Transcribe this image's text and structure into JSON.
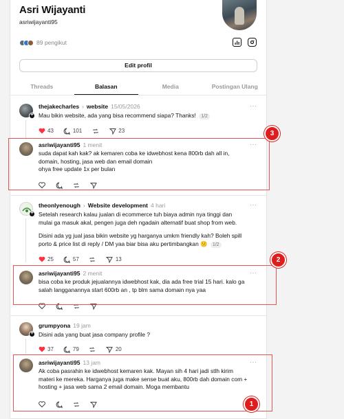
{
  "profile": {
    "name": "Asri Wijayanti",
    "handle": "asriwijayanti95",
    "followers": "89 pengikut",
    "edit_label": "Edit profil"
  },
  "tabs": [
    {
      "label": "Threads",
      "active": false
    },
    {
      "label": "Balasan",
      "active": true
    },
    {
      "label": "Media",
      "active": false
    },
    {
      "label": "Postingan Ulang",
      "active": false
    }
  ],
  "posts": {
    "p1": {
      "user": "thejakecharles",
      "topic": "website",
      "time": "15/05/2026",
      "text": "Mau bikin website, ada yang bisa recommend siapa? Thanks!",
      "pager": "1/2",
      "likes": "43",
      "comments": "101",
      "shares": "23"
    },
    "r1": {
      "user": "asriwijayanti95",
      "time": "1 menit",
      "line1": "suda dapat kah kak? ak kemaren coba ke idwebhost kena 800rb dah all in,",
      "line2": "domain, hosting, jasa web dan email domain",
      "line3": "ohya free update 1x per bulan"
    },
    "p2": {
      "user": "theonlyenough",
      "topic": "Website development",
      "time": "4 hari",
      "para1_l1": "Setelah research kalau jualan di ecommerce tuh biaya admin nya tinggi dan",
      "para1_l2": "mulai ga masuk akal, pengen juga deh ngadain alternatif buat shop from web.",
      "para2_l1": "Disini ada yg jual jasa bikin website yg harganya umkm friendly kah? Boleh spill",
      "para2_l2": "porto & price list di reply / DM yaa biar bisa aku pertimbangkan 😕",
      "pager": "1/2",
      "likes": "25",
      "comments": "57",
      "shares": "13"
    },
    "r2": {
      "user": "asriwijayanti95",
      "time": "2 menit",
      "line1": "bisa coba ke produk jejualannya idwebhost kak, dia ada free trial 15 hari. kalo ga",
      "line2": "salah langganannya start 600rb an , tp blm sama domain nya yaa"
    },
    "p3": {
      "user": "grumpyona",
      "time": "19 jam",
      "text": "Disini ada yang buat jasa company profile ?",
      "likes": "37",
      "comments": "79",
      "shares": "20"
    },
    "r3": {
      "user": "asriwijayanti95",
      "time": "13 jam",
      "line1": "Ak coba pasrahin ke idwebhost kemaren kak. Mayan sih 4 hari jadi stlh kirim",
      "line2": "materi ke mereka. Harganya juga make sense buat aku, 800rb dah domain com +",
      "line3": "hosting + jasa web sama 2 email domain. Moga membantu"
    }
  },
  "more_label": "···",
  "chevron": "›",
  "badges": {
    "b1": "1",
    "b2": "2",
    "b3": "3"
  },
  "colors": {
    "like_red": "#ff3040",
    "annotation_red": "#e01d1d"
  }
}
